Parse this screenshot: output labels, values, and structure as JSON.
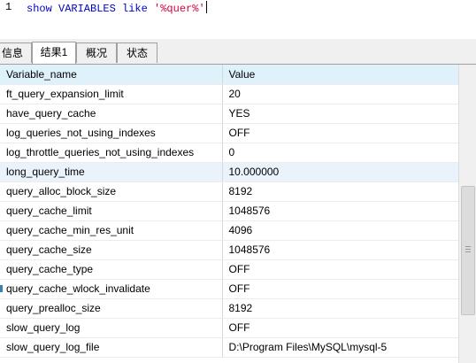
{
  "editor": {
    "line_number": "1",
    "keyword": "show VARIABLES like ",
    "string": "'%quer%'"
  },
  "tabs": [
    {
      "label": "信息"
    },
    {
      "label": "结果1"
    },
    {
      "label": "概况"
    },
    {
      "label": "状态"
    }
  ],
  "table": {
    "columns": [
      "Variable_name",
      "Value"
    ],
    "rows": [
      {
        "name": "ft_query_expansion_limit",
        "value": "20"
      },
      {
        "name": "have_query_cache",
        "value": "YES"
      },
      {
        "name": "log_queries_not_using_indexes",
        "value": "OFF"
      },
      {
        "name": "log_throttle_queries_not_using_indexes",
        "value": "0"
      },
      {
        "name": "long_query_time",
        "value": "10.000000"
      },
      {
        "name": "query_alloc_block_size",
        "value": "8192"
      },
      {
        "name": "query_cache_limit",
        "value": "1048576"
      },
      {
        "name": "query_cache_min_res_unit",
        "value": "4096"
      },
      {
        "name": "query_cache_size",
        "value": "1048576"
      },
      {
        "name": "query_cache_type",
        "value": "OFF"
      },
      {
        "name": "query_cache_wlock_invalidate",
        "value": "OFF"
      },
      {
        "name": "query_prealloc_size",
        "value": "8192"
      },
      {
        "name": "slow_query_log",
        "value": "OFF"
      },
      {
        "name": "slow_query_log_file",
        "value": "D:\\Program Files\\MySQL\\mysql-5"
      }
    ]
  }
}
